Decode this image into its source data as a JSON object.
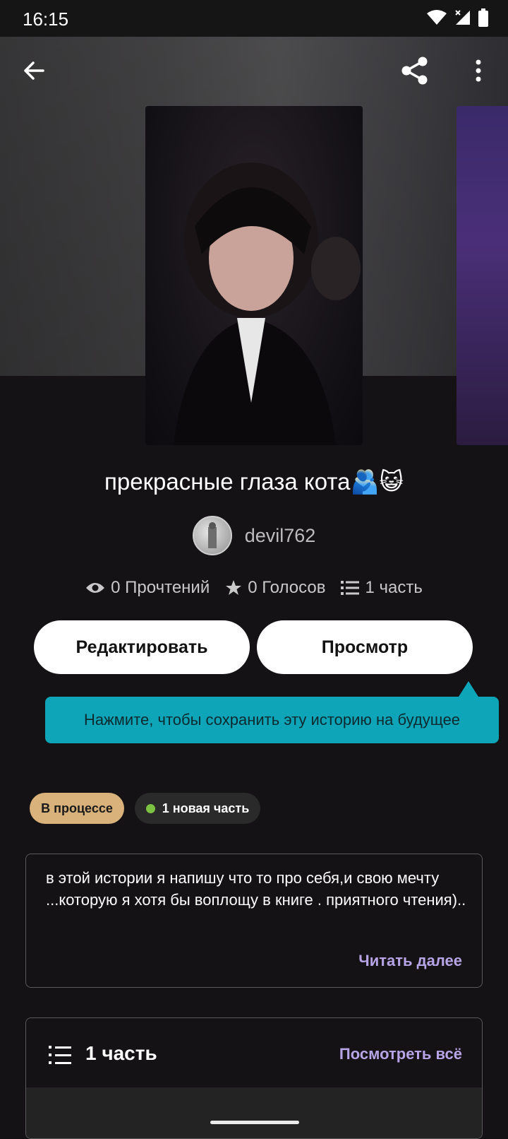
{
  "status_bar": {
    "time": "16:15",
    "icons": [
      "wifi-icon",
      "signal-icon",
      "battery-icon"
    ]
  },
  "toolbar": {
    "back_icon": "arrow-left-icon",
    "share_icon": "share-icon",
    "menu_icon": "more-vertical-icon"
  },
  "story": {
    "title": "прекрасные глаза кота🫂😺",
    "author": "devil762",
    "stats": {
      "reads": "0 Прочтений",
      "votes": "0 Голосов",
      "parts": "1 часть"
    }
  },
  "actions": {
    "edit_label": "Редактировать",
    "preview_label": "Просмотр"
  },
  "tooltip": {
    "text": "Нажмите, чтобы сохранить эту историю на будущее"
  },
  "tags": {
    "status": "В процессе",
    "new_part": "1 новая часть"
  },
  "description": {
    "text": "в этой истории я напишу что то про себя,и свою мечту ...которую я хотя бы воплощу в книге . приятного чтения)..",
    "read_more": "Читать далее"
  },
  "parts_section": {
    "title": "1 часть",
    "view_all": "Посмотреть всё"
  },
  "colors": {
    "background": "#141214",
    "tooltip": "#0fa5b8",
    "status_tag": "#d8b27a",
    "new_dot": "#7cc242",
    "link": "#b7a4e6"
  }
}
